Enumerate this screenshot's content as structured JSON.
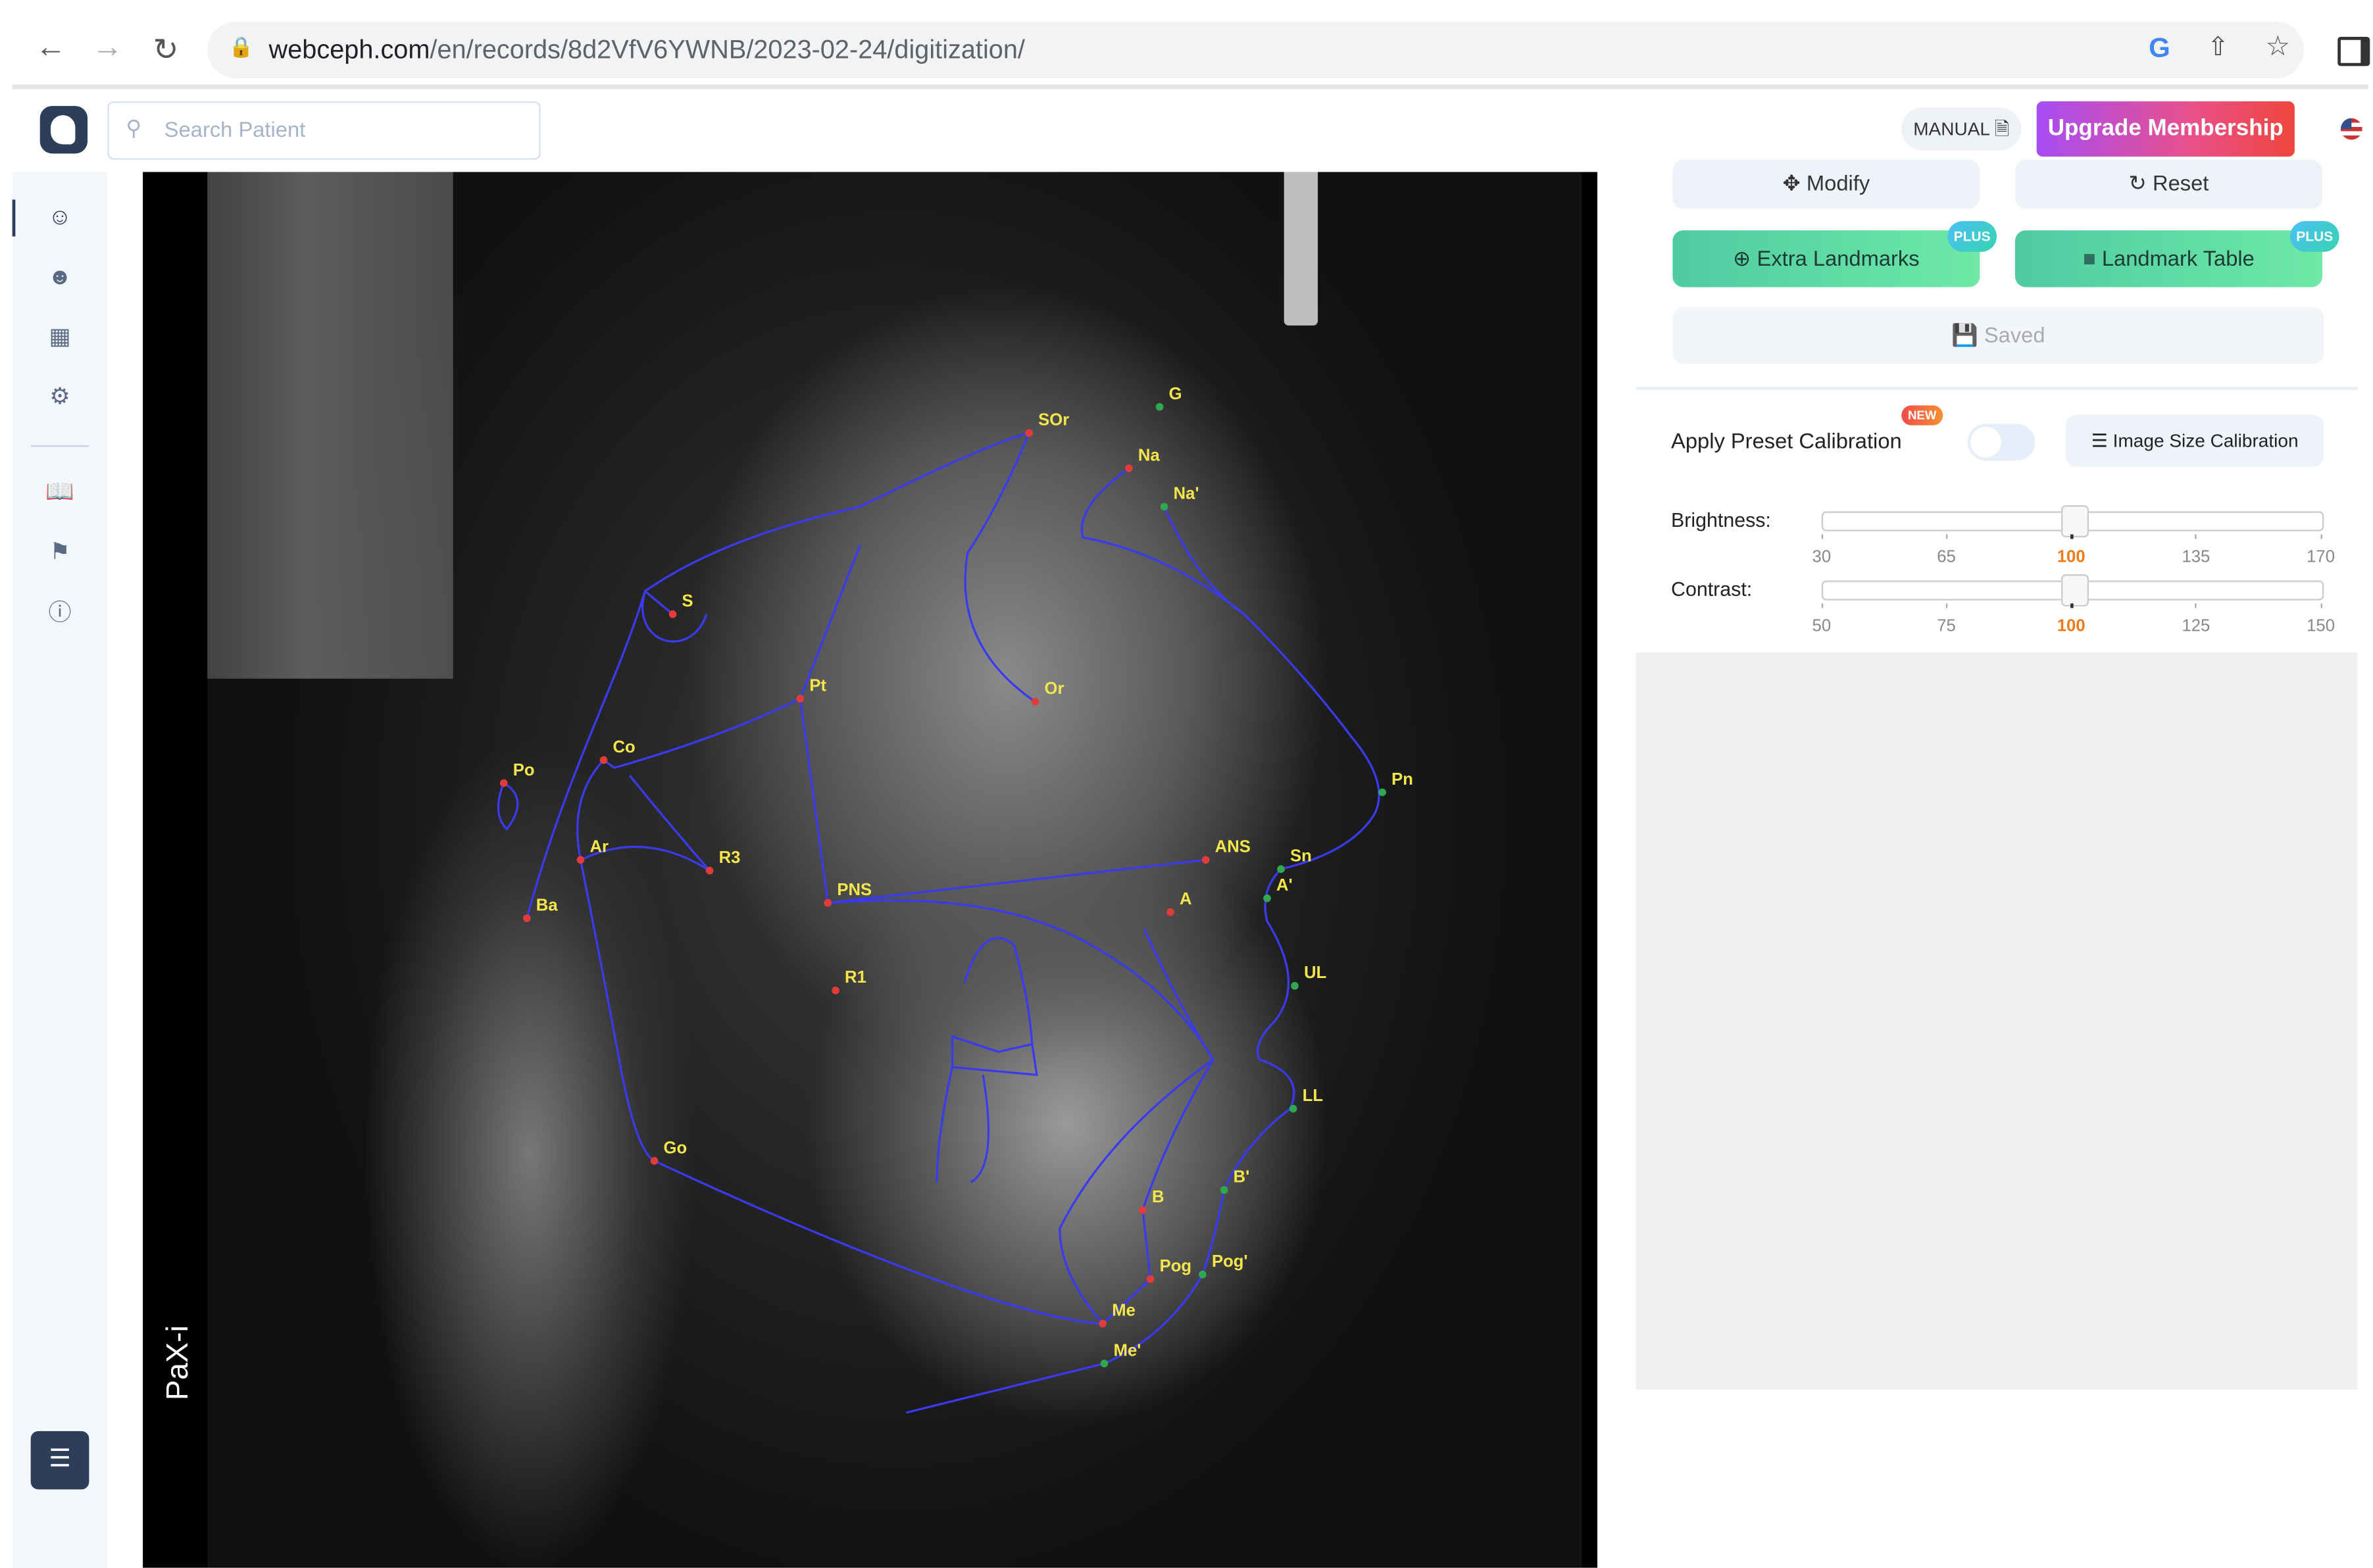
{
  "browser": {
    "url_host": "webceph.com",
    "url_path": "/en/records/8d2VfV6YWNB/2023-02-24/digitization/",
    "icons": [
      "back-icon",
      "forward-icon",
      "reload-icon",
      "lock-icon",
      "google-icon",
      "share-icon",
      "star-icon",
      "sidepanel-icon"
    ]
  },
  "header": {
    "search_placeholder": "Search Patient",
    "manual_label": "MANUAL",
    "upgrade_label": "Upgrade Membership"
  },
  "sidebar": {
    "items": [
      "patient-icon",
      "patients-icon",
      "dashboard-icon",
      "settings-icon",
      "book-icon",
      "tag-icon",
      "info-icon"
    ]
  },
  "xray": {
    "device_label": "PaX-i",
    "landmarks": [
      "G",
      "SOr",
      "Na",
      "Na'",
      "S",
      "Pt",
      "Or",
      "Po",
      "Co",
      "Ar",
      "R3",
      "Ba",
      "PNS",
      "ANS",
      "Sn",
      "A'",
      "A",
      "Pn",
      "UL",
      "LL",
      "R1",
      "Go",
      "B",
      "B'",
      "Pog",
      "Pog'",
      "Me",
      "Me'"
    ],
    "colors": {
      "tracing": "#3a3af0",
      "label": "#f4e64b",
      "hard_point": "#e23b3b",
      "soft_point": "#2fa84f"
    }
  },
  "panel": {
    "modify_label": "Modify",
    "reset_label": "Reset",
    "extra_landmarks_label": "Extra Landmarks",
    "landmark_table_label": "Landmark Table",
    "plus_badge": "PLUS",
    "saved_label": "Saved",
    "preset_label": "Apply Preset Calibration",
    "new_badge": "NEW",
    "preset_enabled": false,
    "image_size_label": "Image Size Calibration",
    "brightness": {
      "label": "Brightness:",
      "value": 100,
      "min": 30,
      "max": 170,
      "ticks": [
        "30",
        "65",
        "100",
        "135",
        "170"
      ]
    },
    "contrast": {
      "label": "Contrast:",
      "value": 100,
      "min": 50,
      "max": 150,
      "ticks": [
        "50",
        "75",
        "100",
        "125",
        "150"
      ]
    }
  }
}
